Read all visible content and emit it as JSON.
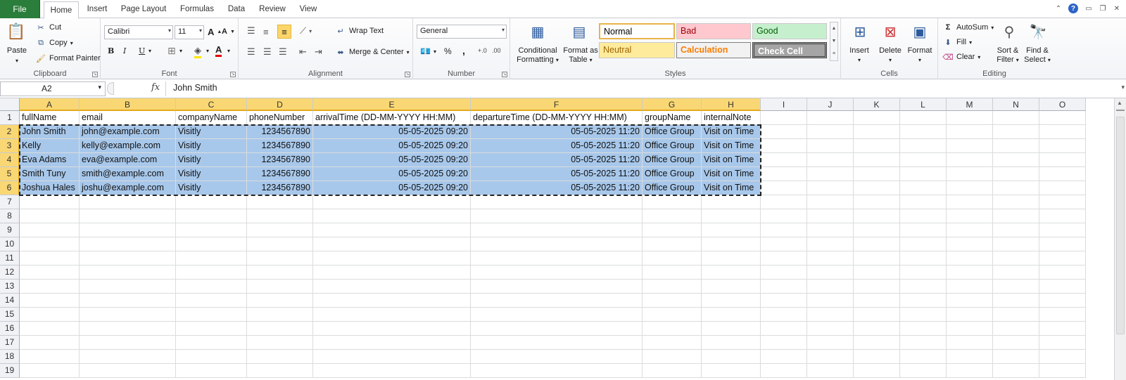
{
  "tabs": {
    "file": "File",
    "home": "Home",
    "insert": "Insert",
    "page_layout": "Page Layout",
    "formulas": "Formulas",
    "data": "Data",
    "review": "Review",
    "view": "View"
  },
  "ribbon": {
    "clipboard": {
      "label": "Clipboard",
      "paste": "Paste",
      "cut": "Cut",
      "copy": "Copy",
      "format_painter": "Format Painter"
    },
    "font": {
      "label": "Font",
      "family": "Calibri",
      "size": "11",
      "bold": "B",
      "italic": "I",
      "underline": "U"
    },
    "alignment": {
      "label": "Alignment",
      "wrap_text": "Wrap Text",
      "merge_center": "Merge & Center"
    },
    "number": {
      "label": "Number",
      "format": "General",
      "percent": "%",
      "comma": ","
    },
    "styles": {
      "label": "Styles",
      "conditional_formatting_1": "Conditional",
      "conditional_formatting_2": "Formatting",
      "format_as_table_1": "Format as",
      "format_as_table_2": "Table",
      "normal": "Normal",
      "bad": "Bad",
      "good": "Good",
      "neutral": "Neutral",
      "calculation": "Calculation",
      "check_cell": "Check Cell"
    },
    "cells": {
      "label": "Cells",
      "insert": "Insert",
      "delete": "Delete",
      "format": "Format"
    },
    "editing": {
      "label": "Editing",
      "autosum": "AutoSum",
      "fill": "Fill",
      "clear": "Clear",
      "sort_filter_1": "Sort &",
      "sort_filter_2": "Filter",
      "find_select_1": "Find &",
      "find_select_2": "Select"
    }
  },
  "formula_bar": {
    "name_box": "A2",
    "fx": "fx",
    "content": "John Smith"
  },
  "grid": {
    "columns": [
      "A",
      "B",
      "C",
      "D",
      "E",
      "F",
      "G",
      "H",
      "I",
      "J",
      "K",
      "L",
      "M",
      "N",
      "O"
    ],
    "rows": [
      "1",
      "2",
      "3",
      "4",
      "5",
      "6",
      "7",
      "8",
      "9",
      "10",
      "11",
      "12",
      "13",
      "14",
      "15",
      "16",
      "17",
      "18",
      "19"
    ],
    "headers": [
      "fullName",
      "email",
      "companyName",
      "phoneNumber",
      "arrivalTime (DD-MM-YYYY HH:MM)",
      "departureTime (DD-MM-YYYY HH:MM)",
      "groupName",
      "internalNote"
    ],
    "data": [
      [
        "John Smith",
        "john@example.com",
        "Visitly",
        "1234567890",
        "05-05-2025 09:20",
        "05-05-2025 11:20",
        "Office Group",
        "Visit on Time"
      ],
      [
        "Kelly",
        "kelly@example.com",
        "Visitly",
        "1234567890",
        "05-05-2025 09:20",
        "05-05-2025 11:20",
        "Office Group",
        "Visit on Time"
      ],
      [
        "Eva Adams",
        "eva@example.com",
        "Visitly",
        "1234567890",
        "05-05-2025 09:20",
        "05-05-2025 11:20",
        "Office Group",
        "Visit on Time"
      ],
      [
        "Smith Tuny",
        "smith@example.com",
        "Visitly",
        "1234567890",
        "05-05-2025 09:20",
        "05-05-2025 11:20",
        "Office Group",
        "Visit on Time"
      ],
      [
        "Joshua Hales",
        "joshu@example.com",
        "Visitly",
        "1234567890",
        "05-05-2025 09:20",
        "05-05-2025 11:20",
        "Office Group",
        "Visit on Time"
      ]
    ]
  },
  "colors": {
    "file_tab": "#2a7d3a",
    "selection": "#a8c8eb",
    "header_selected": "#f9d774",
    "bad_bg": "#ffc7ce",
    "good_bg": "#c6efce",
    "neutral_bg": "#ffeb9c",
    "check_bg": "#a5a5a5"
  }
}
